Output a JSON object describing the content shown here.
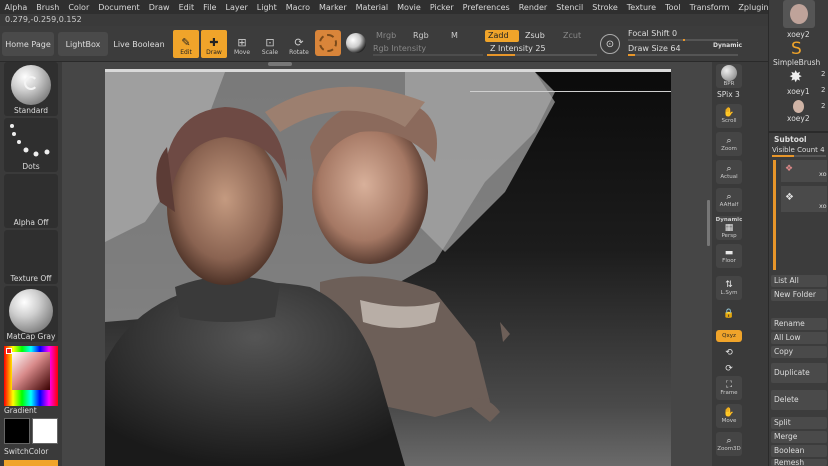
{
  "menubar": [
    "Alpha",
    "Brush",
    "Color",
    "Document",
    "Draw",
    "Edit",
    "File",
    "Layer",
    "Light",
    "Macro",
    "Marker",
    "Material",
    "Movie",
    "Picker",
    "Preferences",
    "Render",
    "Stencil",
    "Stroke",
    "Texture",
    "Tool",
    "Transform",
    "Zplugin",
    "Zscript"
  ],
  "coords": "0.279,-0.259,0.152",
  "shelf": {
    "home": "Home Page",
    "lightbox": "LightBox",
    "liveboolean": "Live Boolean",
    "edit": "Edit",
    "draw": "Draw",
    "move": "Move",
    "scale": "Scale",
    "rotate": "Rotate",
    "mrgb": "Mrgb",
    "rgb": "Rgb",
    "m": "M",
    "zadd": "Zadd",
    "zsub": "Zsub",
    "zcut": "Zcut",
    "rgb_intensity": "Rgb Intensity",
    "z_intensity_label": "Z Intensity",
    "z_intensity_value": "25",
    "focal_shift_label": "Focal Shift",
    "focal_shift_value": "0",
    "draw_size_label": "Draw Size",
    "draw_size_value": "64",
    "dynamic": "Dynamic",
    "z_intensity_fraction": 0.25,
    "draw_size_fraction": 0.06
  },
  "left": {
    "standard": "Standard",
    "dots": "Dots",
    "alpha_off": "Alpha Off",
    "texture_off": "Texture Off",
    "matcap": "MatCap Gray",
    "gradient": "Gradient",
    "switchcolor": "SwitchColor"
  },
  "right": {
    "bpr": "BPR",
    "spix_label": "SPix",
    "spix_value": "3",
    "scroll": "Scroll",
    "zoom": "Zoom",
    "actual": "Actual",
    "aahalf": "AAHalf",
    "dynamic": "Dynamic",
    "persp": "Persp",
    "floor": "Floor",
    "lsym": "L.Sym",
    "xyz": "Qxyz",
    "frame": "Frame",
    "move": "Move",
    "zoom3d": "Zoom3D"
  },
  "palette": {
    "xoey2_top": "xoey2",
    "simplebrush": "SimpleBrush",
    "xoey1": "xoey1",
    "xoey2": "xoey2",
    "num1": "2",
    "num2": "2",
    "num3": "2",
    "subtool": "Subtool",
    "visible_count_label": "Visible Count",
    "visible_count_value": "4",
    "xo1": "xo",
    "xo2": "xo",
    "list_all": "List All",
    "new_folder": "New Folder",
    "rename": "Rename",
    "all_low": "All Low",
    "copy": "Copy",
    "duplicate": "Duplicate",
    "delete": "Delete",
    "split": "Split",
    "merge": "Merge",
    "boolean": "Boolean",
    "remesh": "Remesh"
  },
  "colors": {
    "accent": "#f0a42a",
    "panel": "#3a3a3a",
    "menubar": "#2f2f2f"
  }
}
